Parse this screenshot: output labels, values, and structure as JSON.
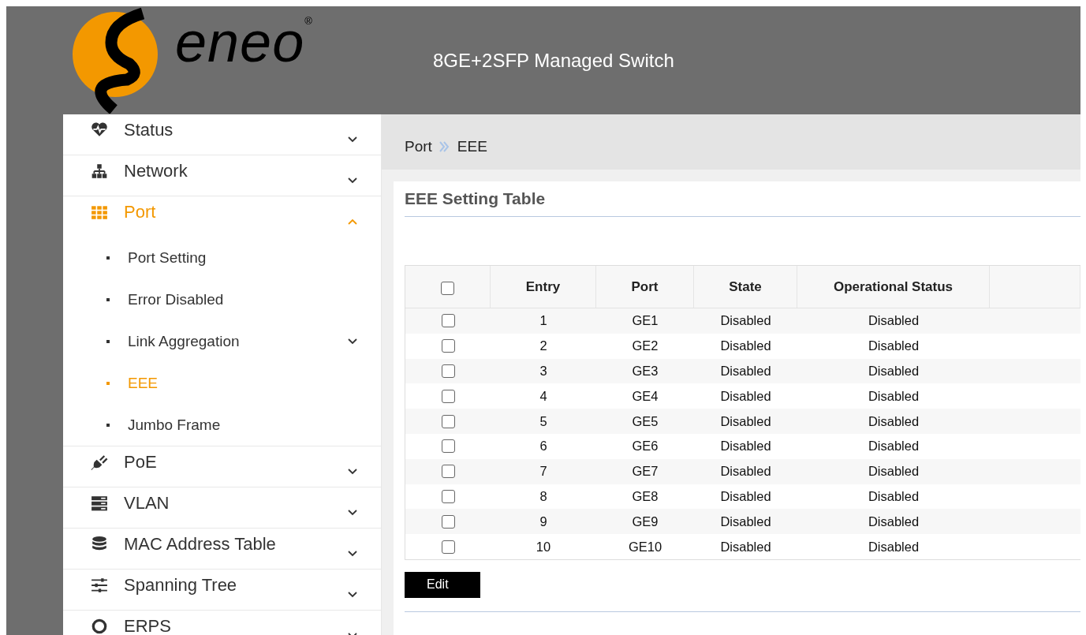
{
  "header": {
    "logo_text": "eneo",
    "logo_mark": "®",
    "title": "8GE+2SFP Managed Switch"
  },
  "sidebar": {
    "items": [
      {
        "label": "Status",
        "selected": false,
        "expanded": false
      },
      {
        "label": "Network",
        "selected": false,
        "expanded": false
      },
      {
        "label": "Port",
        "selected": true,
        "expanded": true,
        "children": [
          {
            "label": "Port Setting",
            "kind": "link",
            "selected": false
          },
          {
            "label": "Error Disabled",
            "kind": "link",
            "selected": false
          },
          {
            "label": "Link Aggregation",
            "kind": "group",
            "selected": false,
            "expanded": false
          },
          {
            "label": "EEE",
            "kind": "link",
            "selected": true
          },
          {
            "label": "Jumbo Frame",
            "kind": "link",
            "selected": false
          }
        ]
      },
      {
        "label": "PoE",
        "selected": false,
        "expanded": false
      },
      {
        "label": "VLAN",
        "selected": false,
        "expanded": false
      },
      {
        "label": "MAC Address Table",
        "selected": false,
        "expanded": false
      },
      {
        "label": "Spanning Tree",
        "selected": false,
        "expanded": false
      },
      {
        "label": "ERPS",
        "selected": false,
        "expanded": false
      }
    ]
  },
  "breadcrumb": [
    "Port",
    "EEE"
  ],
  "card": {
    "title": "EEE Setting Table",
    "table": {
      "select_all_checked": false,
      "columns": [
        "Entry",
        "Port",
        "State",
        "Operational Status"
      ],
      "rows": [
        {
          "checked": false,
          "cells": [
            "1",
            "GE1",
            "Disabled",
            "Disabled"
          ]
        },
        {
          "checked": false,
          "cells": [
            "2",
            "GE2",
            "Disabled",
            "Disabled"
          ]
        },
        {
          "checked": false,
          "cells": [
            "3",
            "GE3",
            "Disabled",
            "Disabled"
          ]
        },
        {
          "checked": false,
          "cells": [
            "4",
            "GE4",
            "Disabled",
            "Disabled"
          ]
        },
        {
          "checked": false,
          "cells": [
            "5",
            "GE5",
            "Disabled",
            "Disabled"
          ]
        },
        {
          "checked": false,
          "cells": [
            "6",
            "GE6",
            "Disabled",
            "Disabled"
          ]
        },
        {
          "checked": false,
          "cells": [
            "7",
            "GE7",
            "Disabled",
            "Disabled"
          ]
        },
        {
          "checked": false,
          "cells": [
            "8",
            "GE8",
            "Disabled",
            "Disabled"
          ]
        },
        {
          "checked": false,
          "cells": [
            "9",
            "GE9",
            "Disabled",
            "Disabled"
          ]
        },
        {
          "checked": false,
          "cells": [
            "10",
            "GE10",
            "Disabled",
            "Disabled"
          ]
        }
      ]
    },
    "buttons": [
      "Edit"
    ]
  }
}
